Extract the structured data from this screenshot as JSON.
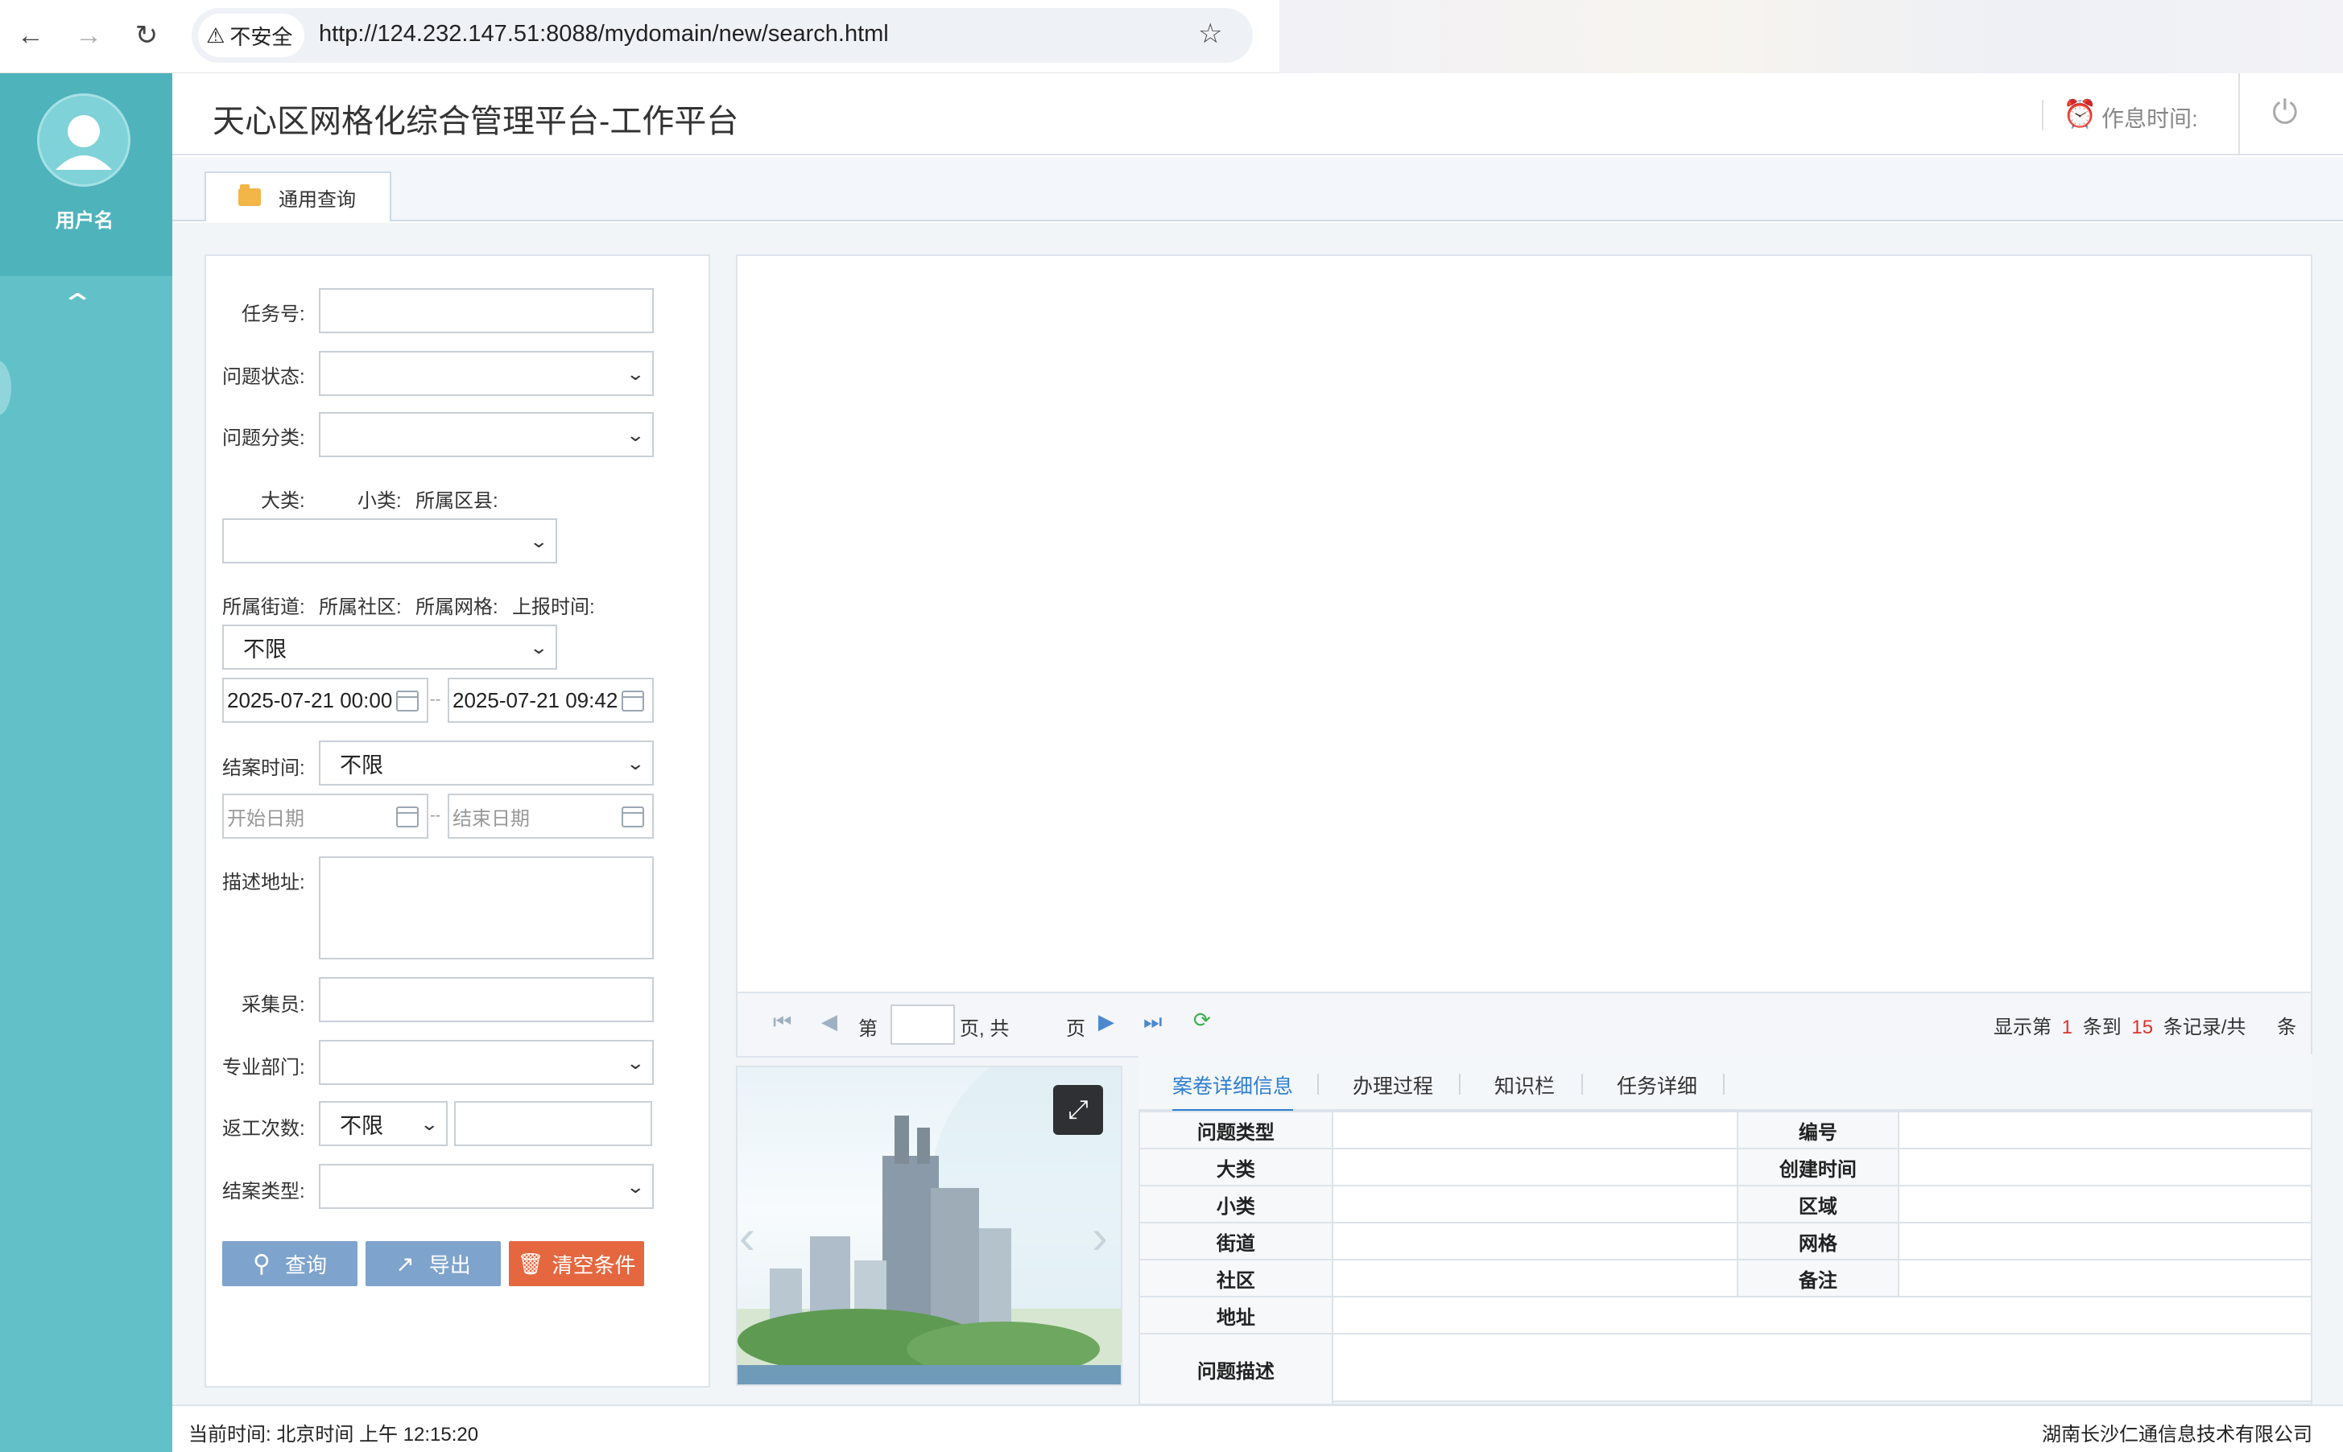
{
  "browser": {
    "back_icon": "back-arrow-icon",
    "forward_icon": "forward-arrow-icon",
    "reload_icon": "reload-icon",
    "security_label": "不安全",
    "url": "http://124.232.147.51:8088/mydomain/new/search.html",
    "bookmark_icon": "star-icon"
  },
  "sidebar": {
    "username": "用户名",
    "avatar_icon": "user-avatar-icon",
    "collapse_icon": "chevron-up-icon"
  },
  "header": {
    "title": "天心区网格化综合管理平台-工作平台",
    "rest_time_label": "作息时间:",
    "clock_icon": "alarm-clock-icon",
    "power_icon": "power-icon"
  },
  "tabs": [
    {
      "label": "通用查询",
      "icon": "folder-icon"
    }
  ],
  "search_form": {
    "task_no": {
      "label": "任务号:",
      "value": ""
    },
    "problem_status": {
      "label": "问题状态:",
      "value": ""
    },
    "problem_category": {
      "label": "问题分类:",
      "value": ""
    },
    "big_class_label": "大类:",
    "small_class_label": "小类:",
    "district_label": "所属区县:",
    "district_value": "",
    "street_label": "所属街道:",
    "community_label": "所属社区:",
    "grid_label": "所属网格:",
    "report_time_label": "上报时间:",
    "report_time_select": "不限",
    "report_start": "2025-07-21 00:00",
    "report_end": "2025-07-21 09:42",
    "date_sep": "--",
    "close_time": {
      "label": "结案时间:",
      "value": "不限"
    },
    "close_start_placeholder": "开始日期",
    "close_end_placeholder": "结束日期",
    "address": {
      "label": "描述地址:",
      "value": ""
    },
    "collector": {
      "label": "采集员:",
      "value": ""
    },
    "department": {
      "label": "专业部门:",
      "value": ""
    },
    "rework": {
      "label": "返工次数:",
      "select": "不限",
      "value": ""
    },
    "close_type": {
      "label": "结案类型:",
      "value": ""
    },
    "buttons": {
      "query": "查询",
      "export": "导出",
      "clear": "清空条件"
    },
    "colors": {
      "query": "#7ea3cc",
      "export": "#7ea3cc",
      "clear": "#e5673f"
    }
  },
  "pager": {
    "page_prefix": "第",
    "page_value": "",
    "page_mid": "页, 共",
    "page_suffix": "页",
    "display_prefix": "显示第",
    "from": "1",
    "to_label": "条到",
    "to": "15",
    "records_label": "条记录/共",
    "total": "",
    "total_suffix": "条",
    "highlight_color": "#d9352b"
  },
  "detail": {
    "tabs": [
      "案卷详细信息",
      "办理过程",
      "知识栏",
      "任务详细"
    ],
    "active_tab_color": "#2f7fd0",
    "rows": [
      {
        "l1": "问题类型",
        "v1": "",
        "l2": "编号",
        "v2": ""
      },
      {
        "l1": "大类",
        "v1": "",
        "l2": "创建时间",
        "v2": ""
      },
      {
        "l1": "小类",
        "v1": "",
        "l2": "区域",
        "v2": ""
      },
      {
        "l1": "街道",
        "v1": "",
        "l2": "网格",
        "v2": ""
      },
      {
        "l1": "社区",
        "v1": "",
        "l2": "备注",
        "v2": ""
      }
    ],
    "address_label": "地址",
    "description_label": "问题描述"
  },
  "footer": {
    "current_time": "当前时间: 北京时间 上午 12:15:20",
    "company": "湖南长沙仁通信息技术有限公司"
  }
}
